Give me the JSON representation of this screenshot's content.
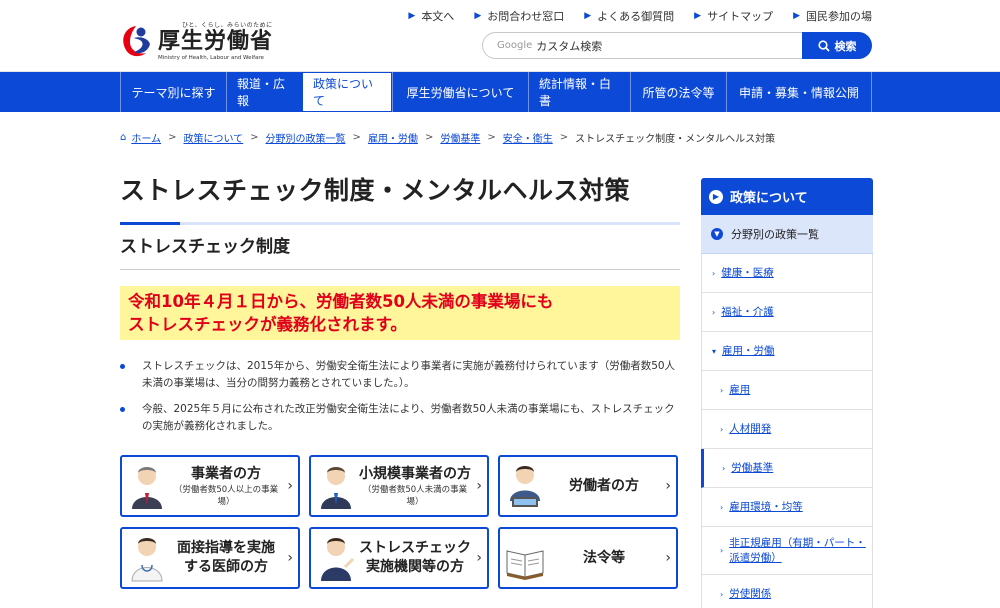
{
  "header": {
    "tagline": "ひと、くらし、みらいのために",
    "logo_name": "厚生労働省",
    "logo_en": "Ministry of Health, Labour and Welfare",
    "util_links": [
      "本文へ",
      "お問合わせ窓口",
      "よくある御質問",
      "サイトマップ",
      "国民参加の場"
    ],
    "search_prefix": "Google",
    "search_placeholder": "カスタム検索",
    "search_button": "検索"
  },
  "gnav": [
    {
      "label": "テーマ別に探す",
      "active": false
    },
    {
      "label": "報道・広報",
      "active": false
    },
    {
      "label": "政策について",
      "active": true
    },
    {
      "label": "厚生労働省について",
      "active": false
    },
    {
      "label": "統計情報・白書",
      "active": false
    },
    {
      "label": "所管の法令等",
      "active": false
    },
    {
      "label": "申請・募集・情報公開",
      "active": false
    }
  ],
  "breadcrumb": [
    "ホーム",
    "政策について",
    "分野別の政策一覧",
    "雇用・労働",
    "労働基準",
    "安全・衛生",
    "ストレスチェック制度・メンタルヘルス対策"
  ],
  "main": {
    "title": "ストレスチェック制度・メンタルヘルス対策",
    "h2": "ストレスチェック制度",
    "notice_line1": "令和10年４月１日から、労働者数50人未満の事業場にも",
    "notice_line2": "ストレスチェックが義務化されます。",
    "bullets": [
      "ストレスチェックは、2015年から、労働安全衛生法により事業者に実施が義務付けられています（労働者数50人未満の事業場は、当分の間努力義務とされていました。）。",
      "今般、2025年５月に公布された改正労働安全衛生法により、労働者数50人未満の事業場にも、ストレスチェックの実施が義務化されました。"
    ],
    "cards": [
      {
        "title": "事業者の方",
        "sub": "（労働者数50人以上の事業場）"
      },
      {
        "title": "小規模事業者の方",
        "sub": "（労働者数50人未満の事業場）"
      },
      {
        "title": "労働者の方",
        "sub": ""
      },
      {
        "title": "面接指導を実施",
        "title2": "する医師の方",
        "sub": ""
      },
      {
        "title": "ストレスチェック",
        "title2": "実施機関等の方",
        "sub": ""
      },
      {
        "title": "法令等",
        "sub": ""
      }
    ]
  },
  "sidebar": {
    "head": "政策について",
    "sub": "分野別の政策一覧",
    "items": [
      "健康・医療",
      "福祉・介護",
      "雇用・労働",
      "雇用",
      "人材開発",
      "労働基準",
      "雇用環境・均等",
      "非正規雇用（有期・パート・派遣労働）",
      "労使関係"
    ]
  },
  "colors": {
    "brand_blue": "#0b49d6",
    "notice_bg": "#fff59a",
    "notice_text": "#e0001b"
  }
}
